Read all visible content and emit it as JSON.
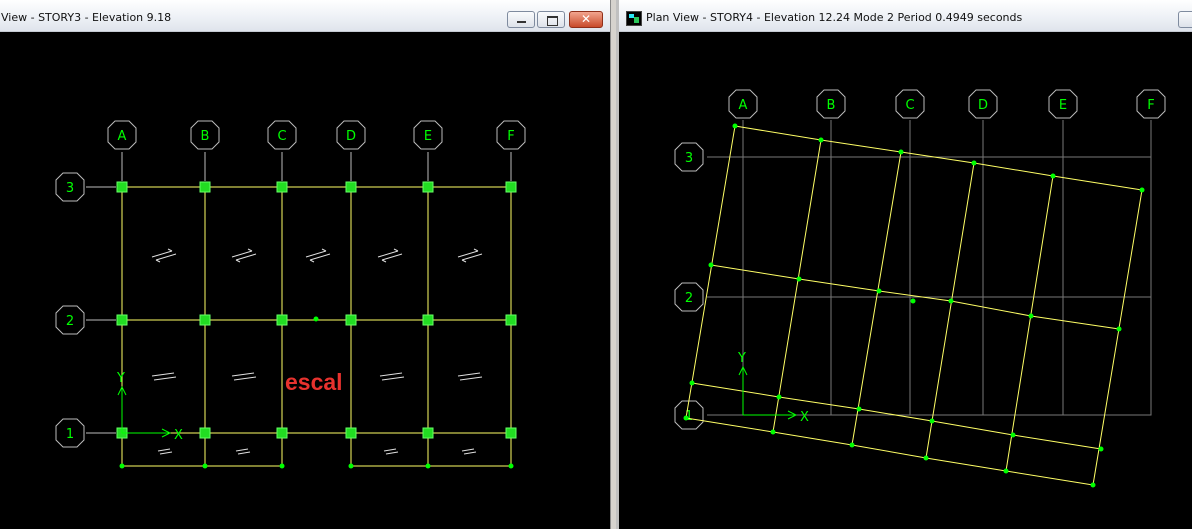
{
  "left_window": {
    "title": "View - STORY3 - Elevation 9.18",
    "grid_x": [
      "A",
      "B",
      "C",
      "D",
      "E",
      "F"
    ],
    "grid_y": [
      "3",
      "2",
      "1"
    ],
    "overlay_text": "escal",
    "axis_x": "X",
    "axis_y": "Y",
    "btn_min": "",
    "btn_max": "",
    "btn_close": "✕"
  },
  "right_window": {
    "title": "Plan View - STORY4 - Elevation 12.24  Mode 2  Period 0.4949 seconds",
    "grid_x": [
      "A",
      "B",
      "C",
      "D",
      "E",
      "F"
    ],
    "grid_y": [
      "3",
      "2",
      "1"
    ],
    "axis_x": "X",
    "axis_y": "Y"
  },
  "colors": {
    "background": "#000000",
    "grid_label": "#00ff00",
    "frame": "#ffff66",
    "overlay_text": "#e8322e"
  }
}
